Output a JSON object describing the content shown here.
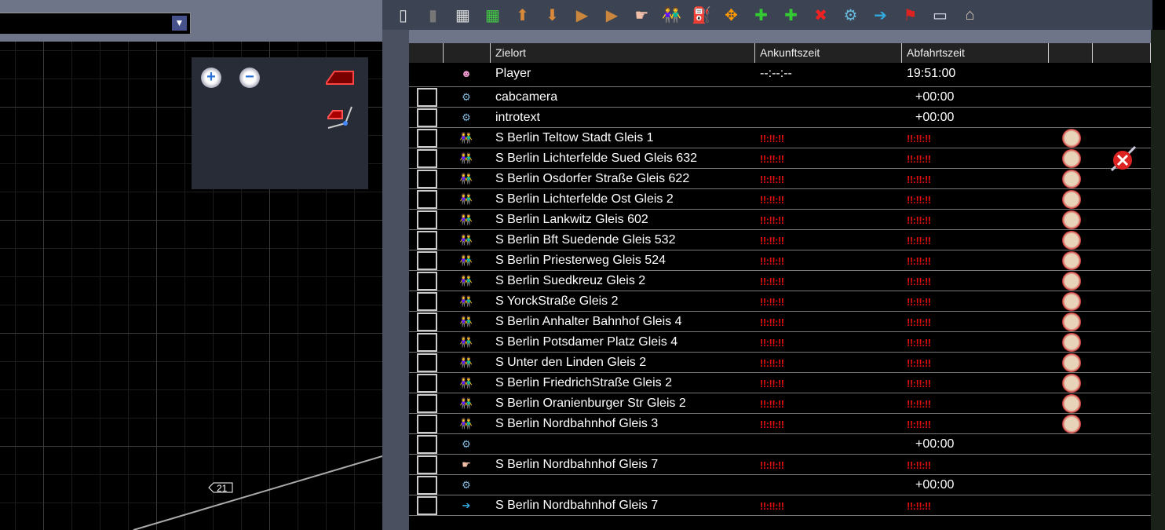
{
  "map": {
    "dropdown_value": "",
    "marker_label": "21"
  },
  "toolbar": {
    "icons": [
      "save-icon",
      "trash-icon",
      "grid-icon",
      "grid-green-icon",
      "move-up-icon",
      "move-down-icon",
      "insert-before-icon",
      "insert-after-icon",
      "pointer-hand-icon",
      "passengers-icon",
      "fuel-station-icon",
      "expand-icon",
      "add-yellow-icon",
      "add-green-icon",
      "delete-instruction-icon",
      "script-settings-icon",
      "exit-icon",
      "flag-icon",
      "ticket-machine-icon",
      "station-icon"
    ]
  },
  "table": {
    "headers": [
      "",
      "",
      "Zielort",
      "Ankunftszeit",
      "Abfahrtszeit",
      "",
      ""
    ],
    "rows": [
      {
        "icon": "driver-icon",
        "checkbox": false,
        "name": "Player",
        "arrival": "--:--:--",
        "departure": "19:51:00",
        "alarm": false
      },
      {
        "icon": "script-icon",
        "checkbox": true,
        "name": "cabcamera",
        "arrival": "",
        "departure": "+00:00",
        "alarm": false
      },
      {
        "icon": "script-icon",
        "checkbox": true,
        "name": "introtext",
        "arrival": "",
        "departure": "+00:00",
        "alarm": false
      },
      {
        "icon": "passengers-icon",
        "checkbox": true,
        "name": "S Berlin Teltow Stadt Gleis 1",
        "arrival": "!!:!!:!!",
        "departure": "!!:!!:!!",
        "alarm": true
      },
      {
        "icon": "passengers-icon",
        "checkbox": true,
        "name": "S Berlin Lichterfelde Sued Gleis 632",
        "arrival": "!!:!!:!!",
        "departure": "!!:!!:!!",
        "alarm": true
      },
      {
        "icon": "passengers-icon",
        "checkbox": true,
        "name": "S Berlin Osdorfer Straße Gleis 622",
        "arrival": "!!:!!:!!",
        "departure": "!!:!!:!!",
        "alarm": true
      },
      {
        "icon": "passengers-icon",
        "checkbox": true,
        "name": "S Berlin Lichterfelde Ost Gleis 2",
        "arrival": "!!:!!:!!",
        "departure": "!!:!!:!!",
        "alarm": true
      },
      {
        "icon": "passengers-icon",
        "checkbox": true,
        "name": "S Berlin Lankwitz Gleis 602",
        "arrival": "!!:!!:!!",
        "departure": "!!:!!:!!",
        "alarm": true
      },
      {
        "icon": "passengers-icon",
        "checkbox": true,
        "name": "S Berlin Bft Suedende Gleis 532",
        "arrival": "!!:!!:!!",
        "departure": "!!:!!:!!",
        "alarm": true
      },
      {
        "icon": "passengers-icon",
        "checkbox": true,
        "name": "S Berlin Priesterweg Gleis 524",
        "arrival": "!!:!!:!!",
        "departure": "!!:!!:!!",
        "alarm": true
      },
      {
        "icon": "passengers-icon",
        "checkbox": true,
        "name": "S Berlin Suedkreuz Gleis 2",
        "arrival": "!!:!!:!!",
        "departure": "!!:!!:!!",
        "alarm": true
      },
      {
        "icon": "passengers-icon",
        "checkbox": true,
        "name": "S YorckStraße Gleis 2",
        "arrival": "!!:!!:!!",
        "departure": "!!:!!:!!",
        "alarm": true
      },
      {
        "icon": "passengers-icon",
        "checkbox": true,
        "name": "S Berlin Anhalter Bahnhof Gleis 4",
        "arrival": "!!:!!:!!",
        "departure": "!!:!!:!!",
        "alarm": true
      },
      {
        "icon": "passengers-icon",
        "checkbox": true,
        "name": "S Berlin Potsdamer Platz Gleis 4",
        "arrival": "!!:!!:!!",
        "departure": "!!:!!:!!",
        "alarm": true
      },
      {
        "icon": "passengers-icon",
        "checkbox": true,
        "name": "S Unter den Linden Gleis 2",
        "arrival": "!!:!!:!!",
        "departure": "!!:!!:!!",
        "alarm": true
      },
      {
        "icon": "passengers-icon",
        "checkbox": true,
        "name": "S Berlin FriedrichStraße Gleis 2",
        "arrival": "!!:!!:!!",
        "departure": "!!:!!:!!",
        "alarm": true
      },
      {
        "icon": "passengers-icon",
        "checkbox": true,
        "name": "S Berlin Oranienburger Str Gleis 2",
        "arrival": "!!:!!:!!",
        "departure": "!!:!!:!!",
        "alarm": true
      },
      {
        "icon": "passengers-icon",
        "checkbox": true,
        "name": "S Berlin Nordbahnhof Gleis 3",
        "arrival": "!!:!!:!!",
        "departure": "!!:!!:!!",
        "alarm": true
      },
      {
        "icon": "script-icon",
        "checkbox": true,
        "name": "",
        "arrival": "",
        "departure": "+00:00",
        "alarm": false
      },
      {
        "icon": "pointer-hand-icon",
        "checkbox": true,
        "name": "S Berlin Nordbahnhof Gleis 7",
        "arrival": "!!:!!:!!",
        "departure": "!!:!!:!!",
        "alarm": false
      },
      {
        "icon": "script-icon",
        "checkbox": true,
        "name": "",
        "arrival": "",
        "departure": "+00:00",
        "alarm": false
      },
      {
        "icon": "exit-icon",
        "checkbox": true,
        "name": "S Berlin Nordbahnhof Gleis 7",
        "arrival": "!!:!!:!!",
        "departure": "!!:!!:!!",
        "alarm": false
      }
    ]
  },
  "colors": {
    "error": "#e01010",
    "panel": "#6f7588",
    "toolbar": "#3c4352"
  }
}
